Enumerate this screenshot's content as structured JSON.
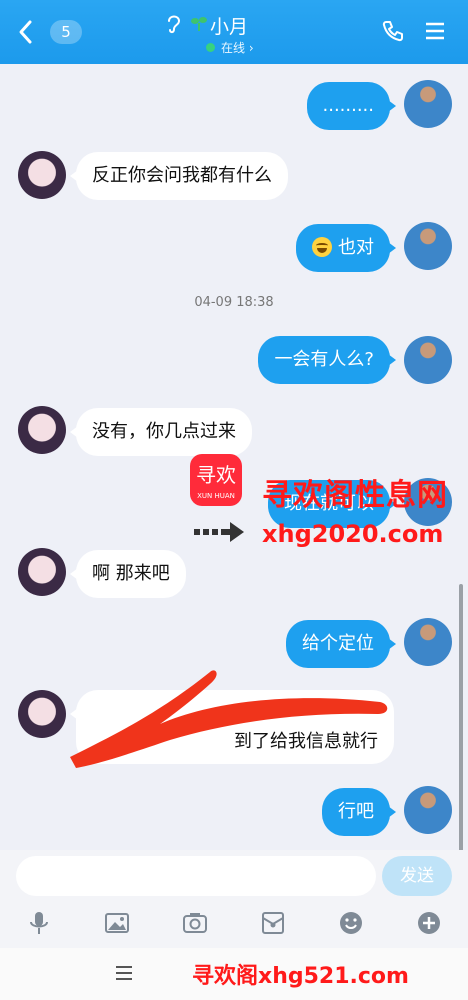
{
  "header": {
    "unread_count": "5",
    "contact_name": "小月",
    "status": "在线 ›"
  },
  "messages": [
    {
      "side": "out",
      "text": "........."
    },
    {
      "side": "in",
      "text": "反正你会问我都有什么"
    },
    {
      "side": "out",
      "text": "也对",
      "emoji": "laughing-emoji"
    },
    {
      "side": "out",
      "text": "一会有人么?"
    },
    {
      "side": "in",
      "text": "没有，你几点过来"
    },
    {
      "side": "out",
      "text": "现在就可以"
    },
    {
      "side": "in",
      "text": "啊 那来吧"
    },
    {
      "side": "out",
      "text": "给个定位"
    },
    {
      "side": "in",
      "text": "到了给我信息就行"
    },
    {
      "side": "out",
      "text": "行吧"
    }
  ],
  "timestamp": "04-09 18:38",
  "watermark": {
    "logo_text": "寻欢",
    "logo_sub": "XUN HUAN",
    "title": "寻欢阁性息网",
    "url": "xhg2020.com",
    "footer": "寻欢阁xhg521.com"
  },
  "input": {
    "placeholder": "",
    "send_label": "发送"
  },
  "toolbar_icons": [
    "microphone-icon",
    "image-icon",
    "camera-icon",
    "red-packet-icon",
    "emoji-icon",
    "plus-icon"
  ],
  "colors": {
    "header": "#1c9aec",
    "bubble_out": "#1ea0ef",
    "bubble_in": "#ffffff",
    "watermark": "#ff1a1a"
  }
}
